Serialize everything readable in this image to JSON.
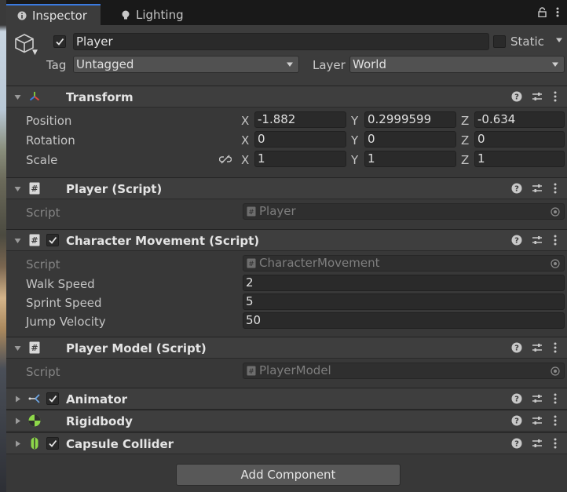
{
  "tabs": [
    {
      "label": "Inspector",
      "icon": "info-icon",
      "active": true
    },
    {
      "label": "Lighting",
      "icon": "bulb-icon",
      "active": false
    }
  ],
  "header": {
    "object_name": "Player",
    "active": true,
    "static_label": "Static",
    "static": false,
    "tag_label": "Tag",
    "tag_value": "Untagged",
    "layer_label": "Layer",
    "layer_value": "World"
  },
  "transform": {
    "title": "Transform",
    "position": {
      "label": "Position",
      "x": "-1.882",
      "y": "0.2999599",
      "z": "-0.634"
    },
    "rotation": {
      "label": "Rotation",
      "x": "0",
      "y": "0",
      "z": "0"
    },
    "scale": {
      "label": "Scale",
      "x": "1",
      "y": "1",
      "z": "1"
    },
    "axis_x": "X",
    "axis_y": "Y",
    "axis_z": "Z"
  },
  "player_script": {
    "title": "Player (Script)",
    "script_label": "Script",
    "script_value": "Player"
  },
  "character_movement": {
    "title": "Character Movement (Script)",
    "enabled": true,
    "script_label": "Script",
    "script_value": "CharacterMovement",
    "walk_speed_label": "Walk Speed",
    "walk_speed": "2",
    "sprint_speed_label": "Sprint Speed",
    "sprint_speed": "5",
    "jump_velocity_label": "Jump Velocity",
    "jump_velocity": "50"
  },
  "player_model": {
    "title": "Player Model (Script)",
    "script_label": "Script",
    "script_value": "PlayerModel"
  },
  "animator": {
    "title": "Animator",
    "enabled": true
  },
  "rigidbody": {
    "title": "Rigidbody"
  },
  "capsule_collider": {
    "title": "Capsule Collider",
    "enabled": true
  },
  "add_component_label": "Add Component",
  "colors": {
    "tab_accent": "#3a7ae0",
    "panel_bg": "#383838",
    "header_bg": "#3e3e3e",
    "field_bg": "#2a2a2a",
    "rigidbody_icon": "#8ed84a",
    "collider_icon": "#8ed84a"
  }
}
